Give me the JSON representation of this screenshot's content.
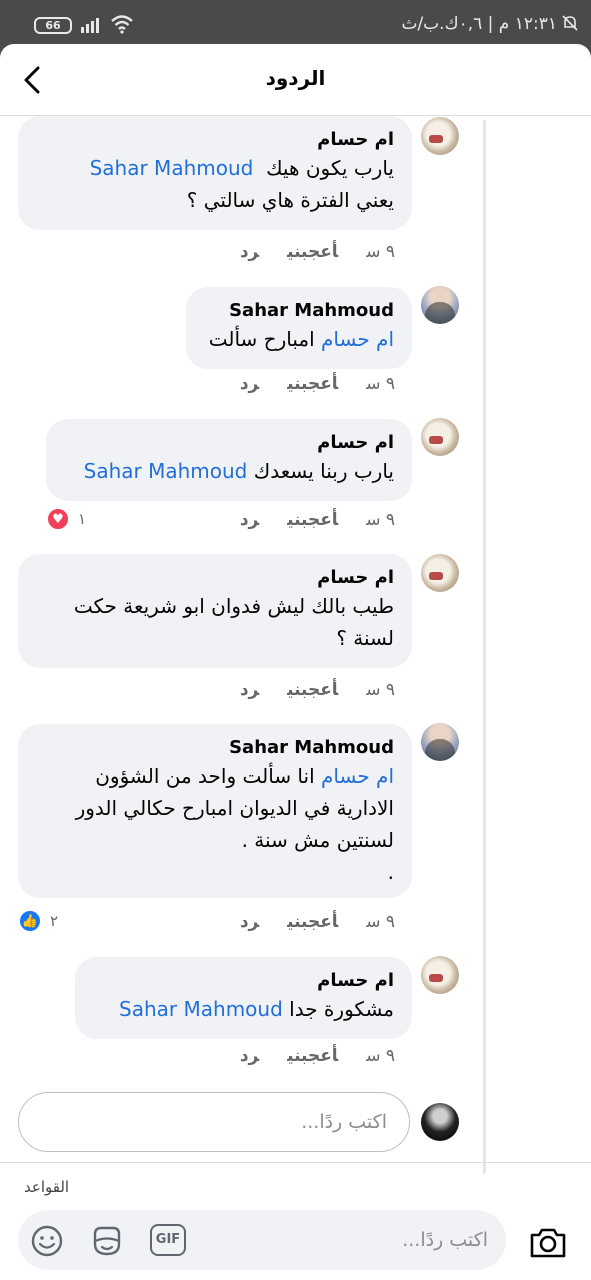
{
  "status_bar": {
    "time": "١٢:٣١ م | ٠,٦ك.ب/ث",
    "battery": "66"
  },
  "header": {
    "title": "الردود"
  },
  "comments": [
    {
      "author": "ام حسام",
      "lines": [
        {
          "mention": "Sahar Mahmoud",
          "text": "يارب يكون هيك"
        },
        {
          "mention": "",
          "text": "يعني الفترة هاي سالتي ؟"
        }
      ],
      "time": "٩ س",
      "like": "أعجبني",
      "reply": "رد"
    },
    {
      "author": "Sahar Mahmoud",
      "lines": [
        {
          "mention": "ام حسام",
          "text": "امبارح سألت"
        }
      ],
      "time": "٩ س",
      "like": "أعجبني",
      "reply": "رد"
    },
    {
      "author": "ام حسام",
      "lines": [
        {
          "mention": "Sahar Mahmoud",
          "text": "يارب ربنا يسعدك"
        }
      ],
      "time": "٩ س",
      "like": "أعجبني",
      "reply": "رد",
      "reaction": {
        "icon": "heart-icon",
        "count": "١"
      }
    },
    {
      "author": "ام حسام",
      "lines": [
        {
          "mention": "",
          "text": "طيب بالك ليش فدوان ابو شريعة حكت"
        },
        {
          "mention": "",
          "text": "لسنة ؟"
        }
      ],
      "time": "٩ س",
      "like": "أعجبني",
      "reply": "رد"
    },
    {
      "author": "Sahar Mahmoud",
      "lines": [
        {
          "mention": "ام حسام",
          "text": "انا سألت واحد من الشؤون"
        },
        {
          "mention": "",
          "text": "الادارية في الديوان امبارح حكالي الدور"
        },
        {
          "mention": "",
          "text": "لسنتين مش سنة ."
        },
        {
          "mention": "",
          "text": "."
        }
      ],
      "time": "٩ س",
      "like": "أعجبني",
      "reply": "رد",
      "reaction": {
        "icon": "thumbs-up-icon",
        "count": "٢"
      }
    },
    {
      "author": "ام حسام",
      "lines": [
        {
          "mention": "Sahar Mahmoud",
          "text": "مشكورة جدا"
        }
      ],
      "time": "٩ س",
      "like": "أعجبني",
      "reply": "رد"
    }
  ],
  "thread_reply": {
    "placeholder": "اكتب ردًا..."
  },
  "footer": {
    "rules_label": "القواعد",
    "composer_placeholder": "اكتب ردًا...",
    "gif_label": "GIF"
  }
}
